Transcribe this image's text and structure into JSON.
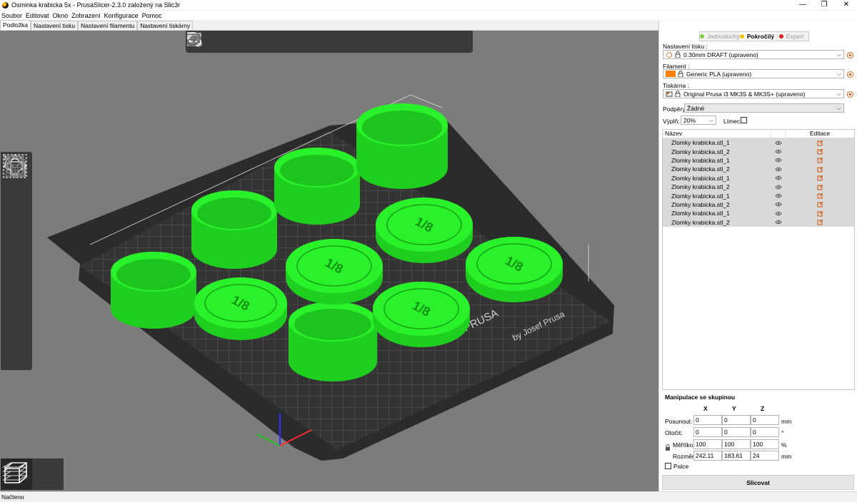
{
  "window": {
    "title": "Osminka krabicka 5x - PrusaSlicer-2.3.0 založený na Slic3r",
    "minimize": "—",
    "maximize": "❐",
    "close": "✕"
  },
  "menu": [
    "Soubor",
    "Editovat",
    "Okno",
    "Zobrazení",
    "Konfigurace",
    "Pomoc"
  ],
  "tabs": [
    {
      "label": "Podložka",
      "active": true
    },
    {
      "label": "Nastavení tisku",
      "active": false
    },
    {
      "label": "Nastavení filamentu",
      "active": false
    },
    {
      "label": "Nastavení tiskárny",
      "active": false
    }
  ],
  "toolbar_icons": [
    "add-object-icon",
    "delete-object-icon",
    "delete-all-icon",
    "arrange-icon",
    "copy-icon",
    "paste-icon",
    "add-instance-icon",
    "remove-instance-icon",
    "split-objects-icon",
    "split-parts-icon",
    "search-icon",
    "layer-editing-icon",
    "undo-icon",
    "redo-icon"
  ],
  "left_toolbar_icons": [
    "move-icon",
    "scale-icon",
    "rotate-icon",
    "place-on-face-icon",
    "cut-icon",
    "paint-supports-icon",
    "seam-painting-icon",
    "sla-support-icon"
  ],
  "view_toggle": [
    "3d-view-icon",
    "preview-layers-icon"
  ],
  "plate_text": [
    "by Josef Prusa",
    "PRUSA"
  ],
  "modes": [
    {
      "label": "Jednoduchý",
      "color": "#7fd13b",
      "active": false
    },
    {
      "label": "Pokročilý",
      "color": "#f4c20d",
      "active": true
    },
    {
      "label": "Expert",
      "color": "#e02020",
      "active": false
    }
  ],
  "print_settings": {
    "label": "Nastavení tisku :",
    "value": "0.30mm DRAFT (upraveno)"
  },
  "filament": {
    "label": "Filament :",
    "value": "Generic PLA (upraveno)",
    "color": "#ff7f00"
  },
  "printer": {
    "label": "Tiskárna :",
    "value": "Original Prusa i3 MK3S & MK3S+ (upraveno)"
  },
  "supports": {
    "label": "Podpěry:",
    "value": "Žádné"
  },
  "infill": {
    "label": "Výplň:",
    "value": "20%"
  },
  "brim": {
    "label": "Límec:"
  },
  "object_list": {
    "col_name": "Název",
    "col_edit": "Editace",
    "items": [
      "Zlomky krabicka.stl_1",
      "Zlomky krabicka.stl_2",
      "Zlomky krabicka.stl_1",
      "Zlomky krabicka.stl_2",
      "Zlomky krabicka.stl_1",
      "Zlomky krabicka.stl_2",
      "Zlomky krabicka.stl_1",
      "Zlomky krabicka.stl_2",
      "Zlomky krabicka.stl_1",
      "Zlomky krabicka.stl_2"
    ]
  },
  "manipulation": {
    "title": "Manipulace se skupinou",
    "axes": [
      "X",
      "Y",
      "Z"
    ],
    "position": {
      "label": "Posunout:",
      "x": "0",
      "y": "0",
      "z": "0",
      "unit": "mm"
    },
    "rotation": {
      "label": "Otočit:",
      "x": "0",
      "y": "0",
      "z": "0",
      "unit": "°"
    },
    "scale": {
      "label": "Měřítko:",
      "x": "100",
      "y": "100",
      "z": "100",
      "unit": "%"
    },
    "size": {
      "label": "Rozměr:",
      "x": "242.11",
      "y": "183.61",
      "z": "24",
      "unit": "mm"
    },
    "inches": "Palce"
  },
  "slice_button": "Slicovat",
  "status": "Načteno"
}
